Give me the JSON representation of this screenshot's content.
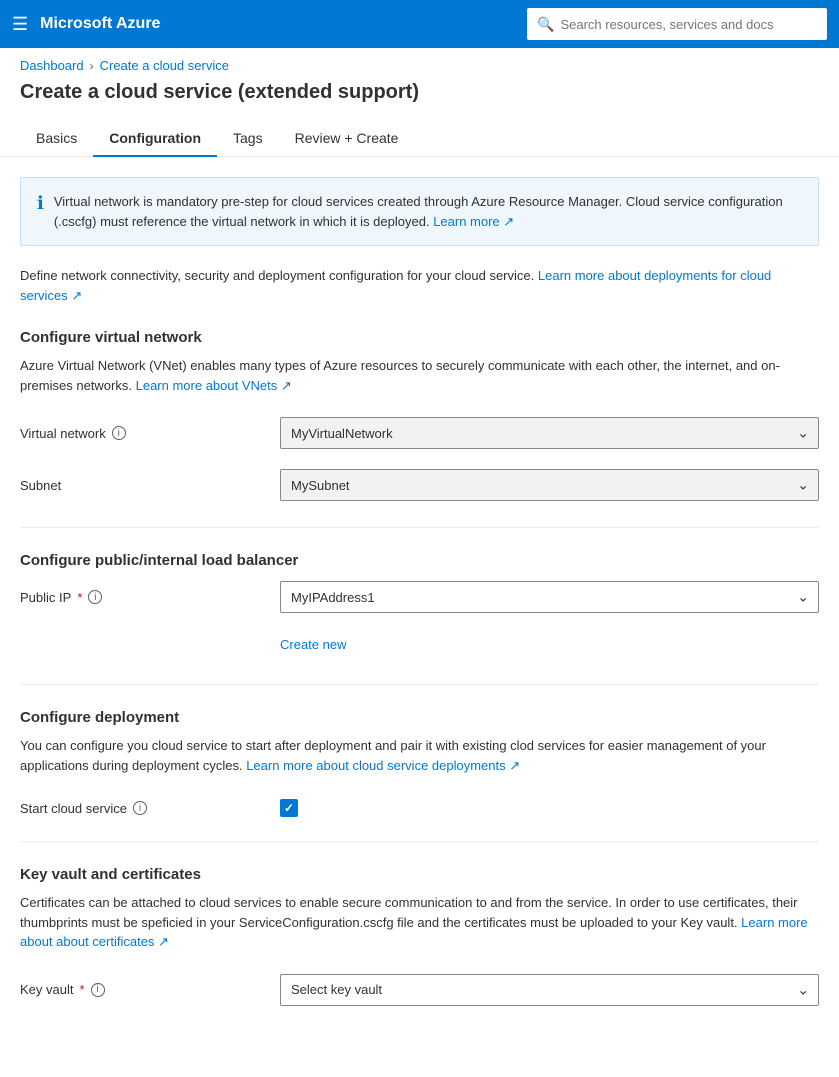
{
  "topnav": {
    "title": "Microsoft Azure",
    "search_placeholder": "Search resources, services and docs"
  },
  "breadcrumb": {
    "items": [
      {
        "label": "Dashboard",
        "link": true
      },
      {
        "label": "Create a cloud service",
        "link": true
      }
    ]
  },
  "page_title": "Create a cloud service (extended support)",
  "tabs": [
    {
      "label": "Basics",
      "active": false
    },
    {
      "label": "Configuration",
      "active": true
    },
    {
      "label": "Tags",
      "active": false
    },
    {
      "label": "Review + Create",
      "active": false
    }
  ],
  "info_box": {
    "text": "Virtual network is mandatory pre-step for cloud services created through Azure Resource Manager. Cloud service configuration (.cscfg) must reference the virtual network in which it is deployed.",
    "link_text": "Learn more",
    "link_icon": "↗"
  },
  "desc_text": "Define network connectivity, security and deployment configuration for your cloud service.",
  "desc_link_text": "Learn more about deployments for cloud services",
  "desc_link_icon": "↗",
  "sections": {
    "virtual_network": {
      "heading": "Configure virtual network",
      "description": "Azure Virtual Network (VNet) enables many types of Azure resources to securely communicate with each other, the internet, and on-premises networks.",
      "link_text": "Learn more about VNets",
      "link_icon": "↗",
      "fields": [
        {
          "label": "Virtual network",
          "info": true,
          "value": "MyVirtualNetwork",
          "required": false
        },
        {
          "label": "Subnet",
          "info": false,
          "value": "MySubnet",
          "required": false
        }
      ]
    },
    "load_balancer": {
      "heading": "Configure public/internal load balancer",
      "fields": [
        {
          "label": "Public IP",
          "info": true,
          "value": "MyIPAddress1",
          "required": true
        }
      ],
      "create_new_label": "Create new"
    },
    "deployment": {
      "heading": "Configure deployment",
      "description": "You can configure you cloud service to start after deployment and pair it with existing clod services for easier management of your applications during deployment cycles.",
      "link_text": "Learn more about cloud service deployments",
      "link_icon": "↗",
      "start_cloud_service_label": "Start cloud service",
      "start_cloud_service_checked": true
    },
    "key_vault": {
      "heading": "Key vault and certificates",
      "description": "Certificates can be attached to cloud services to enable secure communication to and from the service. In order to use certificates, their thumbprints must be speficied in your ServiceConfiguration.cscfg file and the certificates must be uploaded to your Key vault.",
      "link_text": "Learn more about about certificates",
      "link_icon": "↗",
      "fields": [
        {
          "label": "Key vault",
          "info": true,
          "placeholder": "Select key vault",
          "required": true
        }
      ]
    }
  }
}
